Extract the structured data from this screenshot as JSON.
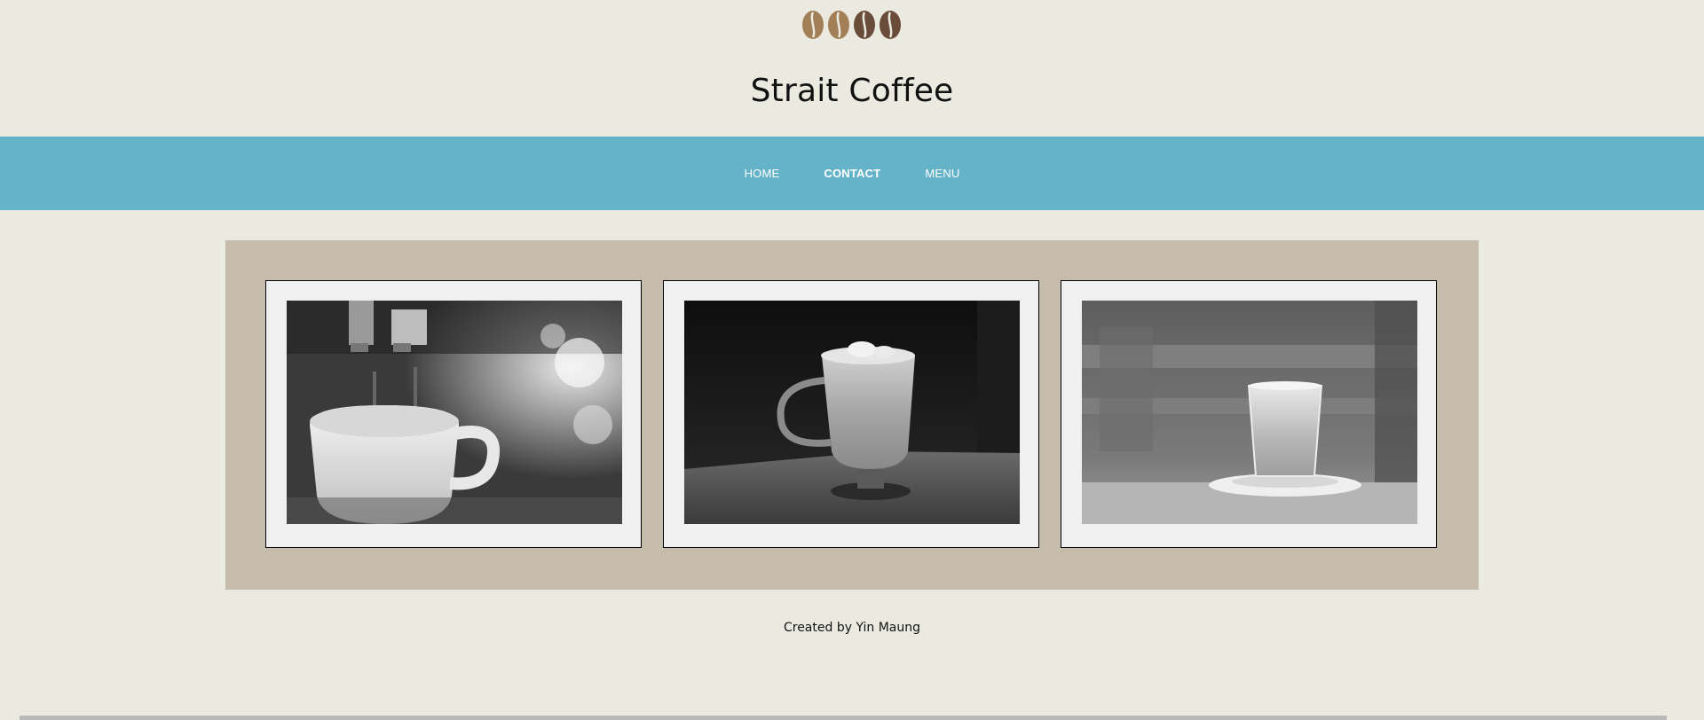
{
  "header": {
    "logo_icon": "coffee-beans-icon",
    "title": "Strait Coffee",
    "colors": {
      "bean_light": "#a37f58",
      "bean_dark": "#6a4c3a"
    }
  },
  "nav": {
    "background": "#64b3c8",
    "items": [
      {
        "label": "HOME",
        "active": false
      },
      {
        "label": "CONTACT",
        "active": true
      },
      {
        "label": "MENU",
        "active": false
      }
    ]
  },
  "gallery": {
    "background": "#c5bcab",
    "photos": [
      {
        "subject": "espresso-pouring-photo"
      },
      {
        "subject": "coffee-mug-photo"
      },
      {
        "subject": "glass-coffee-photo"
      }
    ]
  },
  "footer": {
    "credit": "Created by Yin Maung"
  }
}
